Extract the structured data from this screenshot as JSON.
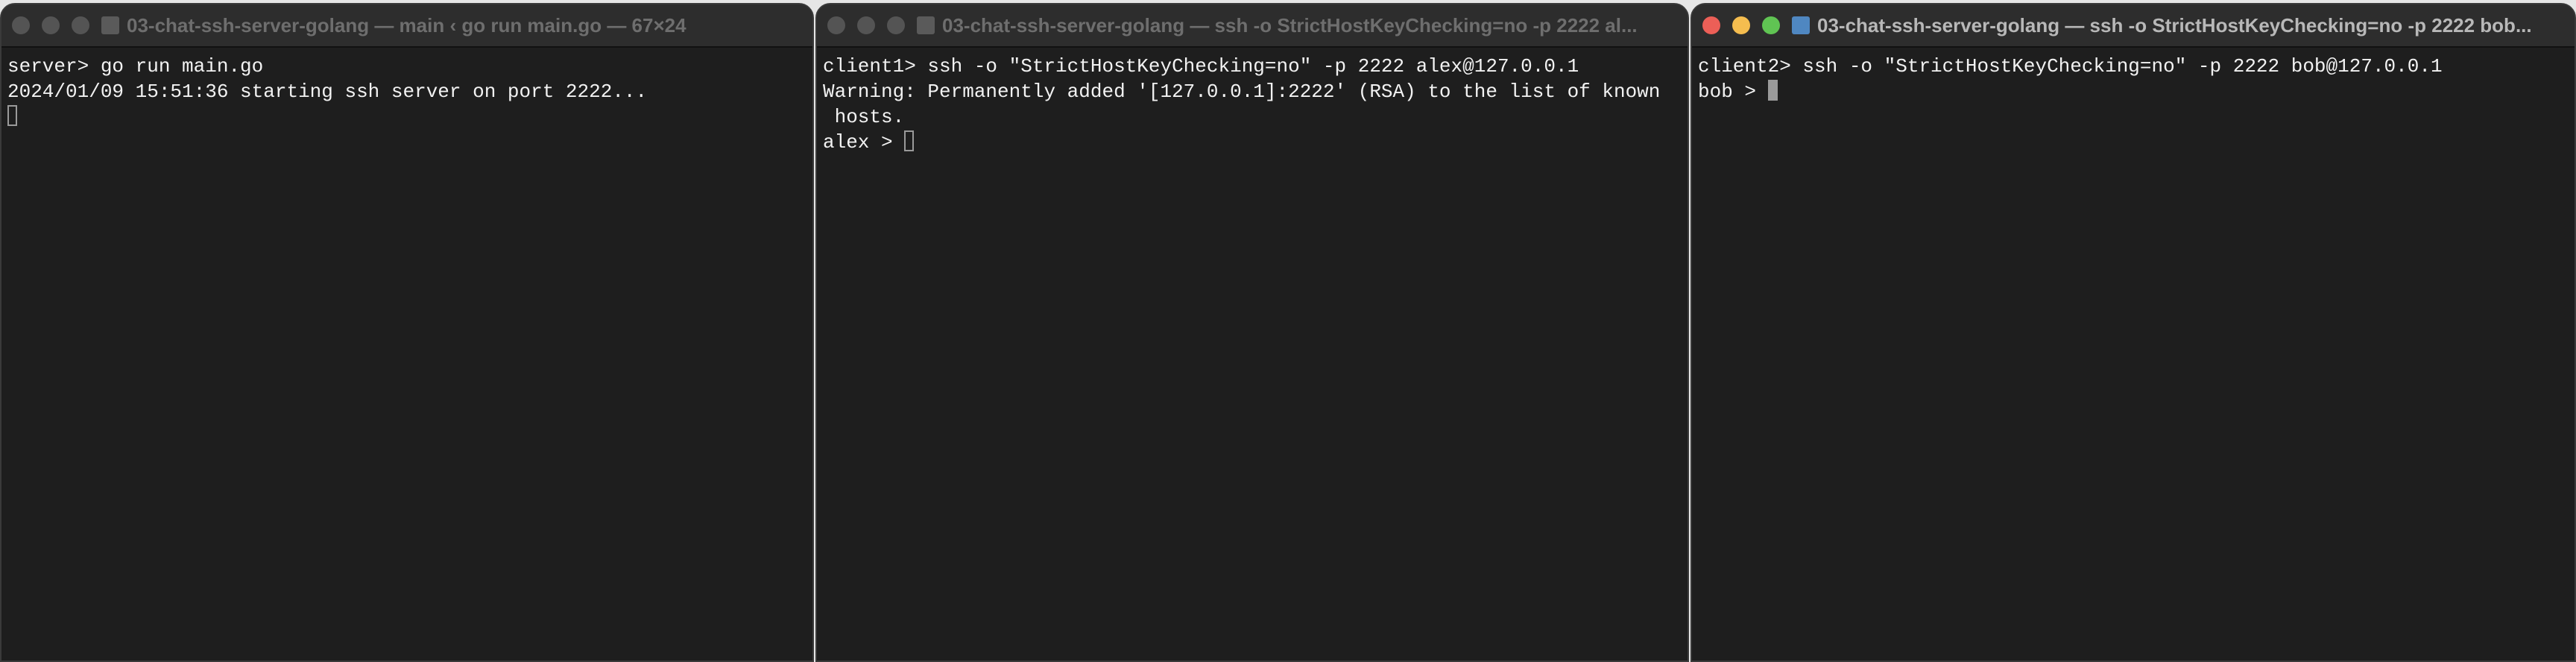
{
  "windows": [
    {
      "title": "03-chat-ssh-server-golang — main ‹ go run main.go — 67×24",
      "lines": [
        "server> go run main.go",
        "2024/01/09 15:51:36 starting ssh server on port 2222..."
      ],
      "prompt": ""
    },
    {
      "title": "03-chat-ssh-server-golang — ssh -o StrictHostKeyChecking=no -p 2222 al...",
      "lines": [
        "client1> ssh -o \"StrictHostKeyChecking=no\" -p 2222 alex@127.0.0.1",
        "Warning: Permanently added '[127.0.0.1]:2222' (RSA) to the list of known",
        " hosts."
      ],
      "prompt": "alex > "
    },
    {
      "title": "03-chat-ssh-server-golang — ssh -o StrictHostKeyChecking=no -p 2222 bob...",
      "lines": [
        "client2> ssh -o \"StrictHostKeyChecking=no\" -p 2222 bob@127.0.0.1"
      ],
      "prompt": "bob > "
    }
  ]
}
